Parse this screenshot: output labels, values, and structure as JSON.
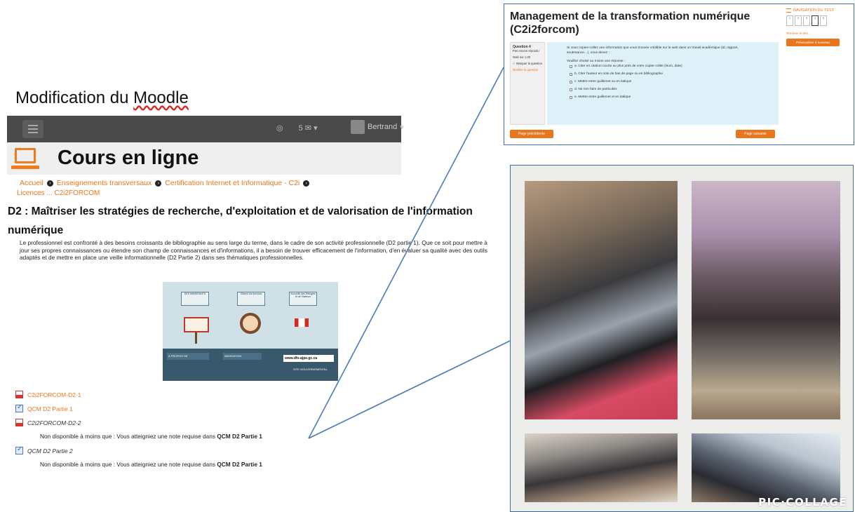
{
  "slide": {
    "title_prefix": "Modification du ",
    "title_word": "Moodle"
  },
  "moodle": {
    "notification_count": "5",
    "user_name": "Bertrand",
    "course_title": "Cours en ligne",
    "breadcrumb": [
      "Accueil",
      "Enseignements transversaux",
      "Certification Internet et Informatique - C2i"
    ],
    "breadcrumb_next_partial": "Licences ... C2i2FORCOM",
    "section_title": "D2 : Maîtriser les stratégies de recherche, d'exploitation et de valorisation de l'information numérique",
    "section_text": "Le professionnel est confronté à des besoins croissants de bibliographie au sens large du terme, dans le cadre de son activité professionnelle (D2 partie 1). Que ce soit pour mettre à jour ses propres connaissances ou étendre son champ de connaissances et d'informations, il a besoin de trouver efficacement de l'information, d'en évaluer sa qualité avec des outils adaptés et de mettre en place une veille informationnelle (D2 Partie 2) dans ses thématiques professionnelles.",
    "infographic": {
      "box1": "DES IMMIGRANTS",
      "box2": "Obtenir les licences",
      "box3": "Accueillir des Réfugiés et de Visiteurs",
      "tab1": "À PROPOS DE",
      "tab2": "NAVIGATION",
      "url": "www.dfs-ajpe.gc.ca",
      "bottom_label": "SITE GOUVERNEMENTAL"
    },
    "activities": [
      {
        "label": "C2i2FORCOM-D2-1",
        "type": "pdf",
        "style": "orange"
      },
      {
        "label": "QCM D2 Partie 1",
        "type": "quiz",
        "style": "orange"
      },
      {
        "label": "C2i2FORCOM-D2-2",
        "type": "pdf",
        "style": "italic"
      },
      {
        "label": "QCM D2 Partie 2",
        "type": "quiz",
        "style": "italic"
      }
    ],
    "restriction_text": "Non disponible à moins que : Vous atteigniez une note requise dans ",
    "restriction_target": "QCM D2 Partie 1"
  },
  "quiz": {
    "title": "Management de la transformation numérique (C2i2forcom)",
    "question_label": "Question 4",
    "question_status": "Pas encore répondu",
    "question_points": "Noté sur 1,00",
    "flag_label": "Marquer la question",
    "edit_label": "Modifier la question",
    "prompt": "Si vous copiez-collez une information que vous trouvée crédible sur le web dans un travail académique (td, rapport, soutenance…), vous devez :",
    "instruction": "Veuillez choisir au moins une réponse :",
    "options": [
      "a. Citer en citation courte au plus près de votre copier-coller (Nom, date)",
      "b. Citer l'auteur en note de bas de page ou en bibliographie",
      "c. Mettre entre guillemet ou en italique",
      "d. Ne rien faire de particulier.",
      "e. Mettre entre guillemet et en italique"
    ],
    "prev_button": "Page précédente",
    "next_button": "Page suivante",
    "nav_title": "NAVIGATION DU TEST",
    "nav_cells": [
      "1",
      "2",
      "3",
      "4",
      "5"
    ],
    "current_question": 4,
    "finish_link": "Terminer le test…",
    "restart_button": "Prévisualiser à nouveau"
  },
  "collage": {
    "watermark": "PIC·COLLAGE"
  },
  "colors": {
    "moodle_orange": "#e8761d",
    "connector_blue": "#4a7bb5"
  }
}
